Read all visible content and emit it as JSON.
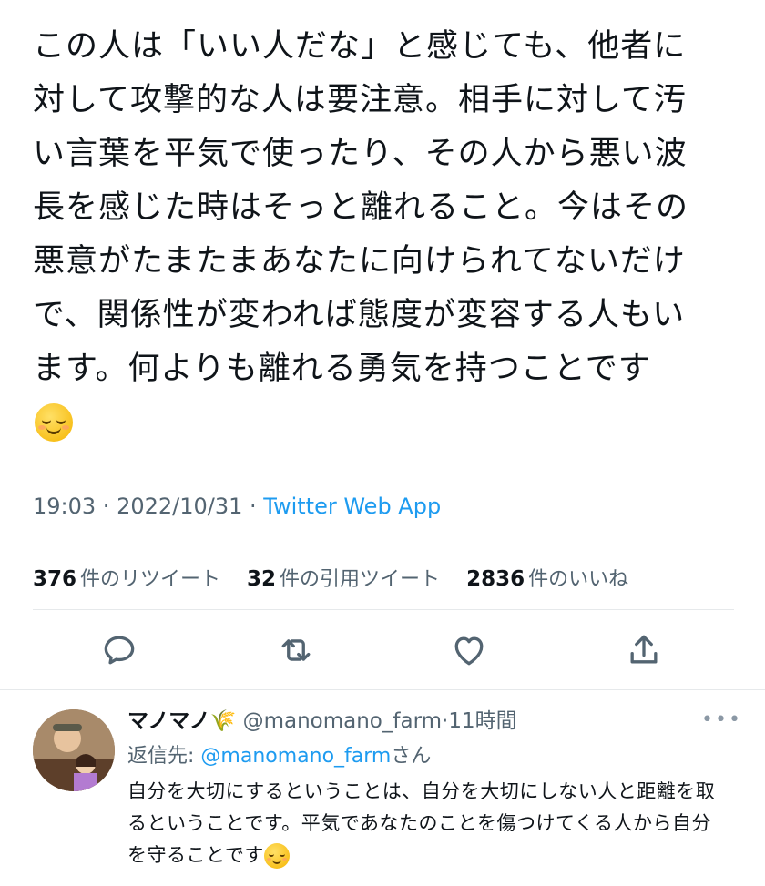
{
  "tweet": {
    "text": "この人は「いい人だな」と感じても、他者に\n対して攻撃的な人は要注意。相手に対して汚\nい言葉を平気で使ったり、その人から悪い波\n長を感じた時はそっと離れること。今はその\n悪意がたまたまあなたに向けられてないだけ\nで、関係性が変われば態度が変容する人もい\nます。何よりも離れる勇気を持つことです",
    "emoji": "relieved-face-emoji",
    "time": "19:03",
    "date": "2022/10/31",
    "source": "Twitter Web App",
    "sep": " · "
  },
  "stats": {
    "retweets_count": "376",
    "retweets_label": "件のリツイート",
    "quotes_count": "32",
    "quotes_label": "件の引用ツイート",
    "likes_count": "2836",
    "likes_label": "件のいいね"
  },
  "actions": {
    "reply_icon": "reply-icon",
    "retweet_icon": "retweet-icon",
    "like_icon": "heart-icon",
    "share_icon": "share-icon"
  },
  "reply": {
    "name": "マノマノ🌾",
    "handle": "@manomano_farm",
    "time": "11時間",
    "dot": "·",
    "reply_to_label": "返信先: ",
    "reply_to_mention": "@manomano_farm",
    "reply_to_suffix": "さん",
    "text": "自分を大切にするということは、自分を大切にしない人と距離を取るということです。平気であなたのことを傷つけてくる人から自分を守ることです",
    "more": "•••"
  },
  "colors": {
    "link": "#1d9bf0",
    "secondary": "#536471",
    "primary": "#0f1419"
  }
}
